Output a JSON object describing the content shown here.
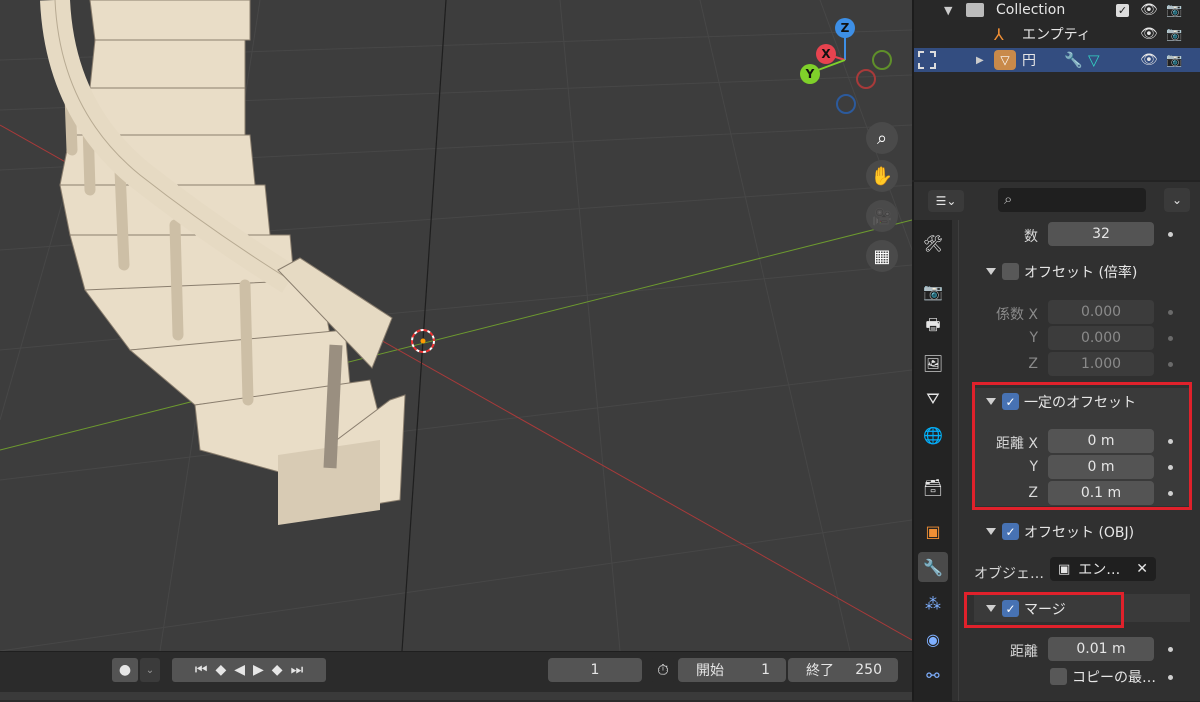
{
  "outliner": {
    "rows": [
      {
        "label": "Collection"
      },
      {
        "label": "エンプティ"
      },
      {
        "label": "円"
      }
    ]
  },
  "gizmo": {
    "x": "X",
    "y": "Y",
    "z": "Z"
  },
  "timeline": {
    "current_frame": "1",
    "start_label": "開始",
    "start_value": "1",
    "end_label": "終了",
    "end_value": "250"
  },
  "properties": {
    "count_label": "数",
    "count_value": "32",
    "relative_offset": {
      "label": "オフセット (倍率)",
      "enabled": false
    },
    "factor_x_label": "係数 X",
    "factor_x": "0.000",
    "factor_y_label": "Y",
    "factor_y": "0.000",
    "factor_z_label": "Z",
    "factor_z": "1.000",
    "constant_offset": {
      "label": "一定のオフセット",
      "enabled": true
    },
    "dist_x_label": "距離 X",
    "dist_x": "0 m",
    "dist_y_label": "Y",
    "dist_y": "0 m",
    "dist_z_label": "Z",
    "dist_z": "0.1 m",
    "object_offset": {
      "label": "オフセット (OBJ)",
      "enabled": true
    },
    "object_label": "オブジェ…",
    "object_value": "エン…",
    "merge": {
      "label": "マージ",
      "enabled": true
    },
    "merge_distance_label": "距離",
    "merge_distance": "0.01 m",
    "copy_first_last_label": "コピーの最…"
  },
  "colors": {
    "accent": "#4772b3",
    "highlight_red": "#e0212b",
    "viewport_bg": "#3d3d3d",
    "x_axis": "#e7434f",
    "y_axis": "#7fd02a",
    "z_axis": "#3d8fe6"
  }
}
